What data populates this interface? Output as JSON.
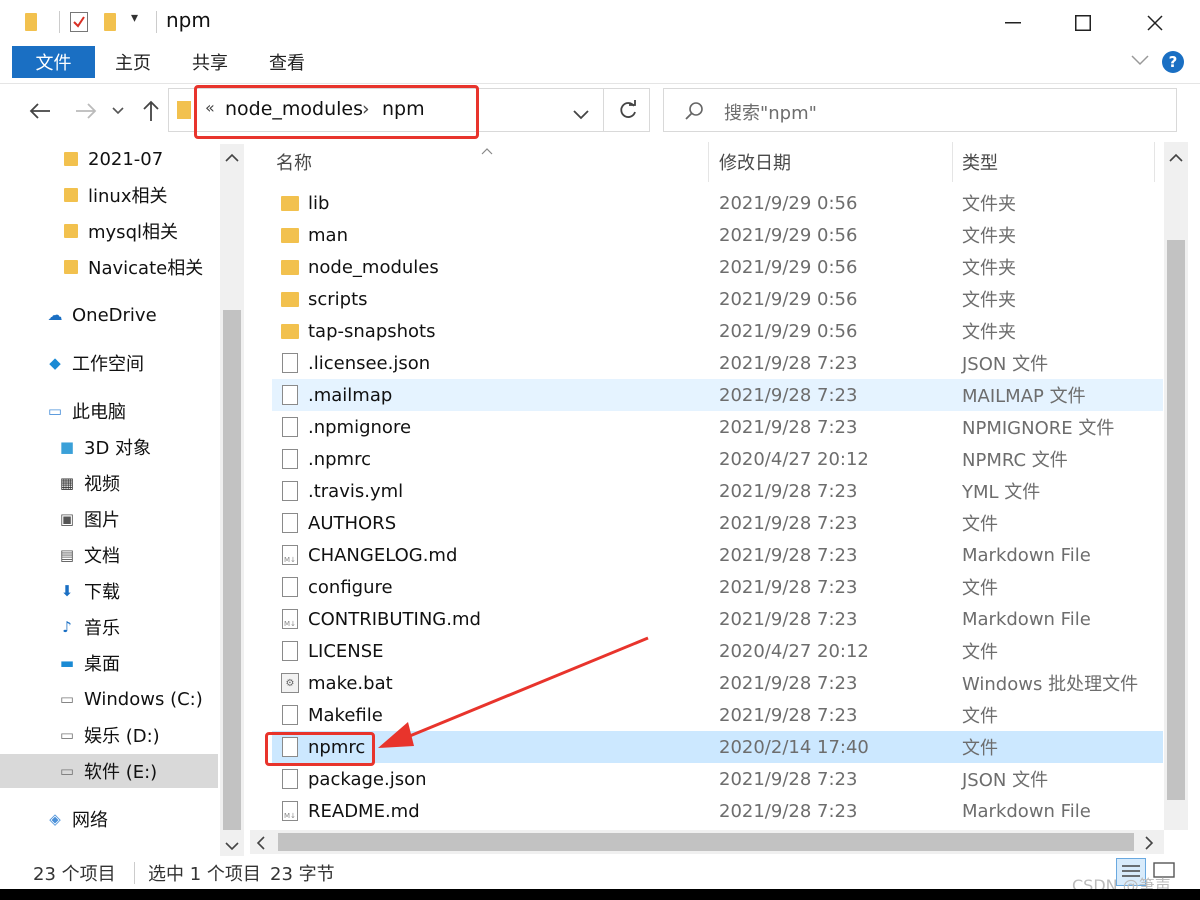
{
  "window": {
    "title": "npm",
    "controls": [
      "minimize-icon",
      "maximize-icon",
      "close-icon"
    ]
  },
  "ribbon": {
    "tabs": [
      "文件",
      "主页",
      "共享",
      "查看"
    ]
  },
  "address": {
    "overflow": "«",
    "crumbs": [
      "node_modules",
      "npm"
    ],
    "separator": "›"
  },
  "search": {
    "placeholder": "搜索\"npm\""
  },
  "navpane": {
    "items": [
      {
        "label": "2021-07",
        "icon": "folder-icon"
      },
      {
        "label": "linux相关",
        "icon": "folder-icon"
      },
      {
        "label": "mysql相关",
        "icon": "folder-icon"
      },
      {
        "label": "Navicate相关",
        "icon": "folder-icon"
      },
      {
        "label": "OneDrive",
        "icon": "cloud-icon"
      },
      {
        "label": "工作空间",
        "icon": "workspace-icon"
      },
      {
        "label": "此电脑",
        "icon": "computer-icon"
      },
      {
        "label": "3D 对象",
        "icon": "cube-icon"
      },
      {
        "label": "视频",
        "icon": "video-icon"
      },
      {
        "label": "图片",
        "icon": "picture-icon"
      },
      {
        "label": "文档",
        "icon": "document-icon"
      },
      {
        "label": "下载",
        "icon": "download-icon"
      },
      {
        "label": "音乐",
        "icon": "music-icon"
      },
      {
        "label": "桌面",
        "icon": "desktop-icon"
      },
      {
        "label": "Windows (C:)",
        "icon": "windows-drive-icon"
      },
      {
        "label": "娱乐 (D:)",
        "icon": "drive-icon"
      },
      {
        "label": "软件 (E:)",
        "icon": "drive-icon"
      },
      {
        "label": "网络",
        "icon": "network-icon"
      }
    ],
    "selected_label": "软件 (E:)"
  },
  "columns": {
    "name": "名称",
    "date": "修改日期",
    "type": "类型"
  },
  "files": [
    {
      "name": "lib",
      "date": "2021/9/29 0:56",
      "type": "文件夹",
      "icon": "folder-icon"
    },
    {
      "name": "man",
      "date": "2021/9/29 0:56",
      "type": "文件夹",
      "icon": "folder-icon"
    },
    {
      "name": "node_modules",
      "date": "2021/9/29 0:56",
      "type": "文件夹",
      "icon": "folder-icon"
    },
    {
      "name": "scripts",
      "date": "2021/9/29 0:56",
      "type": "文件夹",
      "icon": "folder-icon"
    },
    {
      "name": "tap-snapshots",
      "date": "2021/9/29 0:56",
      "type": "文件夹",
      "icon": "folder-icon"
    },
    {
      "name": ".licensee.json",
      "date": "2021/9/28 7:23",
      "type": "JSON 文件",
      "icon": "file-icon"
    },
    {
      "name": ".mailmap",
      "date": "2021/9/28 7:23",
      "type": "MAILMAP 文件",
      "icon": "file-icon"
    },
    {
      "name": ".npmignore",
      "date": "2021/9/28 7:23",
      "type": "NPMIGNORE 文件",
      "icon": "file-icon"
    },
    {
      "name": ".npmrc",
      "date": "2020/4/27 20:12",
      "type": "NPMRC 文件",
      "icon": "file-icon"
    },
    {
      "name": ".travis.yml",
      "date": "2021/9/28 7:23",
      "type": "YML 文件",
      "icon": "file-icon"
    },
    {
      "name": "AUTHORS",
      "date": "2021/9/28 7:23",
      "type": "文件",
      "icon": "file-icon"
    },
    {
      "name": "CHANGELOG.md",
      "date": "2021/9/28 7:23",
      "type": "Markdown File",
      "icon": "markdown-file-icon"
    },
    {
      "name": "configure",
      "date": "2021/9/28 7:23",
      "type": "文件",
      "icon": "file-icon"
    },
    {
      "name": "CONTRIBUTING.md",
      "date": "2021/9/28 7:23",
      "type": "Markdown File",
      "icon": "markdown-file-icon"
    },
    {
      "name": "LICENSE",
      "date": "2020/4/27 20:12",
      "type": "文件",
      "icon": "file-icon"
    },
    {
      "name": "make.bat",
      "date": "2021/9/28 7:23",
      "type": "Windows 批处理文件",
      "icon": "batch-file-icon"
    },
    {
      "name": "Makefile",
      "date": "2021/9/28 7:23",
      "type": "文件",
      "icon": "file-icon"
    },
    {
      "name": "npmrc",
      "date": "2020/2/14 17:40",
      "type": "文件",
      "icon": "file-icon"
    },
    {
      "name": "package.json",
      "date": "2021/9/28 7:23",
      "type": "JSON 文件",
      "icon": "file-icon"
    },
    {
      "name": "README.md",
      "date": "2021/9/28 7:23",
      "type": "Markdown File",
      "icon": "markdown-file-icon"
    }
  ],
  "hovered_file": ".mailmap",
  "selected_file": "npmrc",
  "status": {
    "count": "23 个项目",
    "selection": "选中 1 个项目",
    "size": "23 字节"
  },
  "watermark": "CSDN @筆声",
  "colors": {
    "accent": "#1a6fc3",
    "selection": "#cce8ff",
    "hover": "#e5f3ff",
    "annotation": "#e8342c",
    "folder": "#f2c14e"
  }
}
